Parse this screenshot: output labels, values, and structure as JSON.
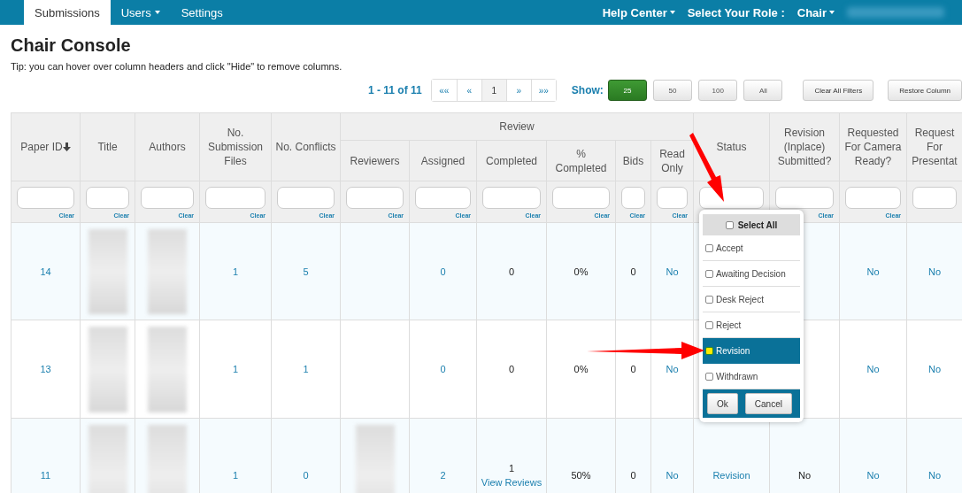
{
  "nav": {
    "tabs": [
      {
        "label": "Submissions",
        "selected": true,
        "caret": false
      },
      {
        "label": "Users",
        "selected": false,
        "caret": true
      },
      {
        "label": "Settings",
        "selected": false,
        "caret": false
      }
    ],
    "help": "Help Center",
    "role_label": "Select Your Role :",
    "role": "Chair"
  },
  "page_title": "Chair Console",
  "tip": "Tip: you can hover over column headers and click \"Hide\" to remove columns.",
  "pager": {
    "summary": "1 - 11 of 11",
    "buttons": [
      {
        "label": "««",
        "selected": false
      },
      {
        "label": "«",
        "selected": false
      },
      {
        "label": "1",
        "selected": true
      },
      {
        "label": "»",
        "selected": false
      },
      {
        "label": "»»",
        "selected": false
      }
    ]
  },
  "show": {
    "label": "Show:",
    "options": [
      {
        "label": "25",
        "selected": true
      },
      {
        "label": "50",
        "selected": false
      },
      {
        "label": "100",
        "selected": false
      },
      {
        "label": "All",
        "selected": false
      }
    ]
  },
  "actions": [
    "Clear All Filters",
    "Restore Column"
  ],
  "table": {
    "column_group": "Review",
    "columns": [
      {
        "label": "Paper ID",
        "sorted": true,
        "clear": "Clear"
      },
      {
        "label": "Title",
        "sorted": false,
        "clear": "Clear"
      },
      {
        "label": "Authors",
        "sorted": false,
        "clear": "Clear"
      },
      {
        "label": "No. Submission Files",
        "sorted": false,
        "clear": "Clear"
      },
      {
        "label": "No. Conflicts",
        "sorted": false,
        "clear": "Clear"
      },
      {
        "grouped": true,
        "label": "Reviewers",
        "sorted": false,
        "clear": "Clear"
      },
      {
        "grouped": true,
        "label": "Assigned",
        "sorted": false,
        "clear": "Clear"
      },
      {
        "grouped": true,
        "label": "Completed",
        "sorted": false,
        "clear": "Clear"
      },
      {
        "grouped": true,
        "label": "% Completed",
        "sorted": false,
        "clear": "Clear"
      },
      {
        "grouped": true,
        "label": "Bids",
        "sorted": false,
        "clear": "Clear"
      },
      {
        "grouped": true,
        "label": "Read Only",
        "sorted": false,
        "clear": "Clear"
      },
      {
        "label": "Status",
        "sorted": false
      },
      {
        "label": "Revision (Inplace) Submitted?",
        "sorted": false,
        "clear": "Clear"
      },
      {
        "label": "Requested For Camera Ready?",
        "sorted": false,
        "clear": "Clear"
      },
      {
        "label": "Request For Presentat",
        "sorted": false
      }
    ],
    "rows": [
      {
        "cells": [
          {
            "kind": "link",
            "lines": [
              "14"
            ]
          },
          {
            "kind": "blurred"
          },
          {
            "kind": "blurred"
          },
          {
            "kind": "link",
            "lines": [
              "1"
            ]
          },
          {
            "kind": "link",
            "lines": [
              "5"
            ]
          },
          {
            "kind": "empty"
          },
          {
            "kind": "link",
            "lines": [
              "0"
            ]
          },
          {
            "kind": "text",
            "lines": [
              "0"
            ]
          },
          {
            "kind": "text",
            "lines": [
              "0%"
            ]
          },
          {
            "kind": "text",
            "lines": [
              "0"
            ]
          },
          {
            "kind": "link",
            "lines": [
              "No"
            ]
          },
          {
            "kind": "empty"
          },
          {
            "kind": "empty"
          },
          {
            "kind": "link",
            "lines": [
              "No"
            ]
          },
          {
            "kind": "link",
            "lines": [
              "No"
            ]
          }
        ]
      },
      {
        "cells": [
          {
            "kind": "link",
            "lines": [
              "13"
            ]
          },
          {
            "kind": "blurred"
          },
          {
            "kind": "blurred"
          },
          {
            "kind": "link",
            "lines": [
              "1"
            ]
          },
          {
            "kind": "link",
            "lines": [
              "1"
            ]
          },
          {
            "kind": "empty"
          },
          {
            "kind": "link",
            "lines": [
              "0"
            ]
          },
          {
            "kind": "text",
            "lines": [
              "0"
            ]
          },
          {
            "kind": "text",
            "lines": [
              "0%"
            ]
          },
          {
            "kind": "text",
            "lines": [
              "0"
            ]
          },
          {
            "kind": "link",
            "lines": [
              "No"
            ]
          },
          {
            "kind": "empty"
          },
          {
            "kind": "empty"
          },
          {
            "kind": "link",
            "lines": [
              "No"
            ]
          },
          {
            "kind": "link",
            "lines": [
              "No"
            ]
          }
        ]
      },
      {
        "cells": [
          {
            "kind": "link",
            "lines": [
              "11"
            ]
          },
          {
            "kind": "blurred"
          },
          {
            "kind": "blurred"
          },
          {
            "kind": "link",
            "lines": [
              "1"
            ]
          },
          {
            "kind": "link",
            "lines": [
              "0"
            ]
          },
          {
            "kind": "blurred"
          },
          {
            "kind": "link",
            "lines": [
              "2"
            ]
          },
          {
            "kind": "mixed",
            "lines": [
              "1",
              "View Reviews"
            ]
          },
          {
            "kind": "text",
            "lines": [
              "50%"
            ]
          },
          {
            "kind": "text",
            "lines": [
              "0"
            ]
          },
          {
            "kind": "link",
            "lines": [
              "No"
            ]
          },
          {
            "kind": "link",
            "lines": [
              "Revision"
            ]
          },
          {
            "kind": "text",
            "lines": [
              "No"
            ]
          },
          {
            "kind": "link",
            "lines": [
              "No"
            ]
          },
          {
            "kind": "link",
            "lines": [
              "No"
            ]
          }
        ]
      }
    ]
  },
  "status_filter": {
    "select_all": {
      "label": "Select All",
      "checked": false
    },
    "options": [
      {
        "label": "Accept",
        "selected": false,
        "checked": false
      },
      {
        "label": "Awaiting Decision",
        "selected": false,
        "checked": false
      },
      {
        "label": "Desk Reject",
        "selected": false,
        "checked": false
      },
      {
        "label": "Reject",
        "selected": false,
        "checked": false
      },
      {
        "label": "Revision",
        "selected": true,
        "checked": false
      },
      {
        "label": "Withdrawn",
        "selected": false,
        "checked": false
      }
    ],
    "ok": "Ok",
    "cancel": "Cancel"
  }
}
